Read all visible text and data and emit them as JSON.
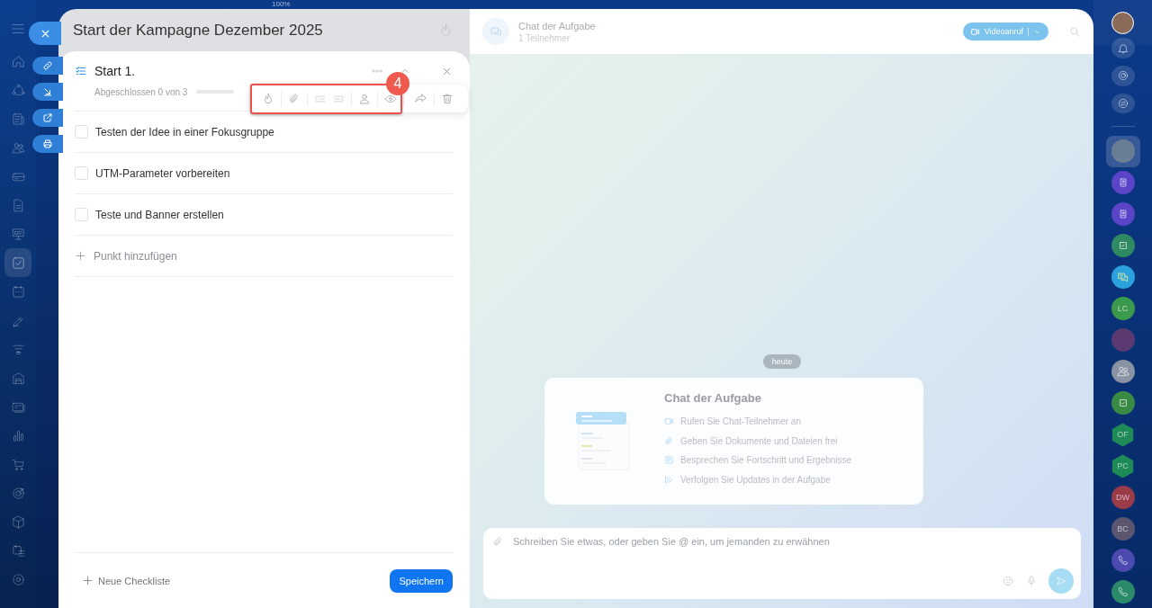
{
  "zoom_label": "100%",
  "sidebar": {
    "items": [
      {
        "selected": false
      },
      {
        "selected": false
      },
      {
        "selected": false
      },
      {
        "selected": false
      },
      {
        "selected": false
      },
      {
        "selected": false
      },
      {
        "selected": false
      },
      {
        "selected": true
      },
      {
        "selected": false
      },
      {
        "selected": false
      },
      {
        "selected": false
      },
      {
        "selected": false
      },
      {
        "selected": false
      },
      {
        "selected": false
      },
      {
        "selected": false
      },
      {
        "selected": false
      },
      {
        "selected": false
      },
      {
        "selected": false
      },
      {
        "selected": false
      }
    ]
  },
  "task": {
    "title": "Start der Kampagne Dezember 2025",
    "checklist": {
      "title": "Start 1.",
      "progress_text": "Abgeschlossen 0 von 3",
      "level": 0,
      "items": [
        {
          "text": "Testen der Idee in einer Fokusgruppe",
          "checked": false
        },
        {
          "text": "UTM-Parameter vorbereiten",
          "checked": false
        },
        {
          "text": "Teste und Banner erstellen",
          "checked": false
        }
      ],
      "add_item": "Punkt hinzufügen"
    },
    "callout": "4",
    "new_checklist": "Neue Checkliste",
    "save": "Speichern"
  },
  "chat": {
    "title": "Chat der Aufgabe",
    "subtitle": "1 Teilnehmer",
    "video_call": "Videoanruf",
    "date_divider": "heute",
    "welcome": {
      "title": "Chat der Aufgabe",
      "features": [
        {
          "kind": "video",
          "text": "Rufen Sie Chat-Teilnehmer an"
        },
        {
          "kind": "clip",
          "text": "Geben Sie Dokumente und Dateien frei"
        },
        {
          "kind": "note",
          "text": "Besprechen Sie Fortschritt und Ergebnisse"
        },
        {
          "kind": "forward",
          "text": "Verfolgen Sie Updates in der Aufgabe"
        }
      ]
    },
    "input": {
      "placeholder": "Schreiben Sie etwas, oder geben Sie @ ein, um jemanden zu erwähnen"
    }
  },
  "right_bar": {
    "chats": [
      {
        "kind": "photo",
        "selected": true,
        "color": "#6b7f94"
      },
      {
        "kind": "contact",
        "selected": false,
        "color": "#5a45c8"
      },
      {
        "kind": "contact",
        "selected": false,
        "color": "#5a45c8"
      },
      {
        "kind": "task",
        "selected": false,
        "color": "#2f8a63"
      },
      {
        "kind": "messages",
        "selected": false,
        "color": "#2aa0dc"
      },
      {
        "kind": "initials",
        "initials": "LC",
        "selected": false,
        "color": "#3c9a4e"
      },
      {
        "kind": "photo",
        "selected": false,
        "color": "#5a3a70"
      },
      {
        "kind": "group",
        "selected": false,
        "color": "#8a93a3"
      },
      {
        "kind": "task",
        "selected": false,
        "color": "#3a8a45"
      },
      {
        "kind": "hex_initials",
        "initials": "OF",
        "selected": false,
        "color": "#1e8a55"
      },
      {
        "kind": "hex_initials",
        "initials": "PC",
        "selected": false,
        "color": "#1e8a55"
      },
      {
        "kind": "initials",
        "initials": "DW",
        "selected": false,
        "color": "#9a3b48"
      },
      {
        "kind": "initials",
        "initials": "BC",
        "selected": false,
        "color": "#5b5670"
      },
      {
        "kind": "phone",
        "selected": false,
        "color": "#4a4ab0"
      },
      {
        "kind": "phone",
        "selected": false,
        "color": "#2a8a6a"
      }
    ]
  }
}
